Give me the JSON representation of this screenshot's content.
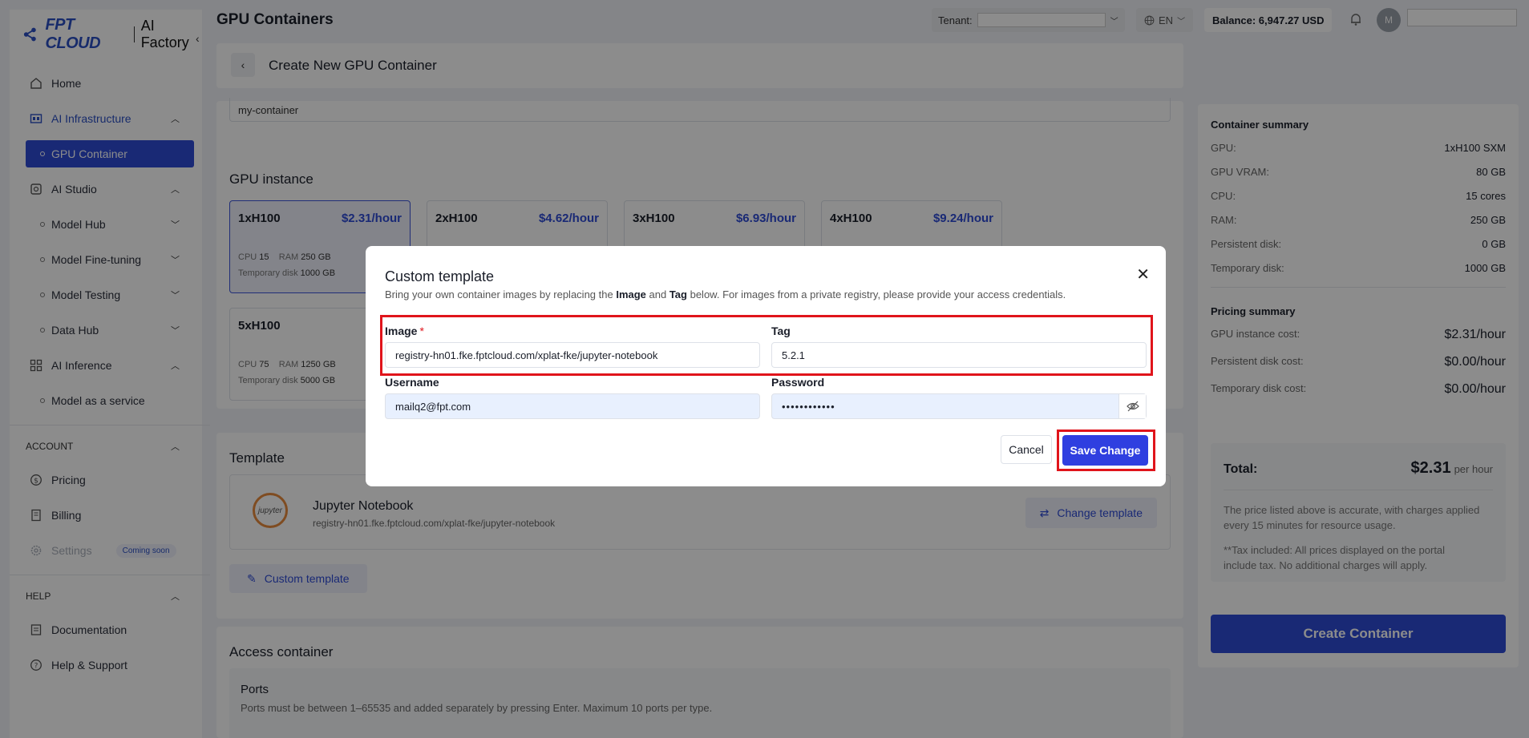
{
  "brand": {
    "logo": "FPT CLOUD",
    "product": "AI Factory"
  },
  "topbar": {
    "page_title": "GPU Containers",
    "tenant_label": "Tenant:",
    "language": "EN",
    "balance": "Balance: 6,947.27 USD",
    "avatar_initial": "M"
  },
  "sidebar": {
    "home": "Home",
    "ai_infrastructure": "AI Infrastructure",
    "gpu_container": "GPU Container",
    "ai_studio": "AI Studio",
    "model_hub": "Model Hub",
    "model_finetuning": "Model Fine-tuning",
    "model_testing": "Model Testing",
    "data_hub": "Data Hub",
    "ai_inference": "AI Inference",
    "model_as_service": "Model as a service",
    "account_section": "ACCOUNT",
    "pricing": "Pricing",
    "billing": "Billing",
    "settings": "Settings",
    "coming_soon": "Coming soon",
    "help_section": "HELP",
    "documentation": "Documentation",
    "help_support": "Help & Support"
  },
  "main": {
    "create_title": "Create New GPU Container",
    "container_name": "my-container",
    "gpu_instance_title": "GPU instance",
    "gpu_cards": [
      {
        "name": "1xH100",
        "price": "$2.31/hour",
        "cpu_label": "CPU",
        "cpu": "15",
        "ram_label": "RAM",
        "ram": "250 GB",
        "disk_label": "Temporary disk",
        "disk": "1000 GB"
      },
      {
        "name": "2xH100",
        "price": "$4.62/hour"
      },
      {
        "name": "3xH100",
        "price": "$6.93/hour"
      },
      {
        "name": "4xH100",
        "price": "$9.24/hour"
      },
      {
        "name": "5xH100",
        "price": "",
        "cpu_label": "CPU",
        "cpu": "75",
        "ram_label": "RAM",
        "ram": "1250 GB",
        "disk_label": "Temporary disk",
        "disk": "5000 GB"
      }
    ],
    "template_title": "Template",
    "template_logo_text": "jupyter",
    "template_name": "Jupyter Notebook",
    "template_image": "registry-hn01.fke.fptcloud.com/xplat-fke/jupyter-notebook",
    "change_template": "Change template",
    "custom_template": "Custom template",
    "access_title": "Access container",
    "ports_title": "Ports",
    "ports_note": "Ports must be between 1–65535 and added separately by pressing Enter. Maximum 10 ports per type."
  },
  "summary": {
    "container_title": "Container summary",
    "rows": [
      {
        "label": "GPU:",
        "value": "1xH100 SXM"
      },
      {
        "label": "GPU VRAM:",
        "value": "80 GB"
      },
      {
        "label": "CPU:",
        "value": "15 cores"
      },
      {
        "label": "RAM:",
        "value": "250 GB"
      },
      {
        "label": "Persistent disk:",
        "value": "0 GB"
      },
      {
        "label": "Temporary disk:",
        "value": "1000 GB"
      }
    ],
    "pricing_title": "Pricing summary",
    "pricing_rows": [
      {
        "label": "GPU instance cost:",
        "value": "$2.31/hour"
      },
      {
        "label": "Persistent disk cost:",
        "value": "$0.00/hour"
      },
      {
        "label": "Temporary disk cost:",
        "value": "$0.00/hour"
      }
    ],
    "total_label": "Total:",
    "total_value": "$2.31",
    "total_unit": "per hour",
    "note1": "The price listed above is accurate, with charges applied every 15 minutes for resource usage.",
    "note2": "**Tax included: All prices displayed on the portal include tax. No additional charges will apply.",
    "create_button": "Create Container"
  },
  "modal": {
    "title": "Custom template",
    "desc_pre": "Bring your own container images by replacing the ",
    "desc_image": "Image",
    "desc_and": " and ",
    "desc_tag": "Tag",
    "desc_post": " below. For images from a private registry, please provide your access credentials.",
    "image_label": "Image",
    "image_required": "*",
    "image_value": "registry-hn01.fke.fptcloud.com/xplat-fke/jupyter-notebook",
    "tag_label": "Tag",
    "tag_value": "5.2.1",
    "username_label": "Username",
    "username_value": "mailq2@fpt.com",
    "password_label": "Password",
    "password_value": "••••••••••••",
    "cancel": "Cancel",
    "save": "Save Change"
  },
  "colors": {
    "accent": "#2f4bd6",
    "highlight": "#e0141b"
  }
}
